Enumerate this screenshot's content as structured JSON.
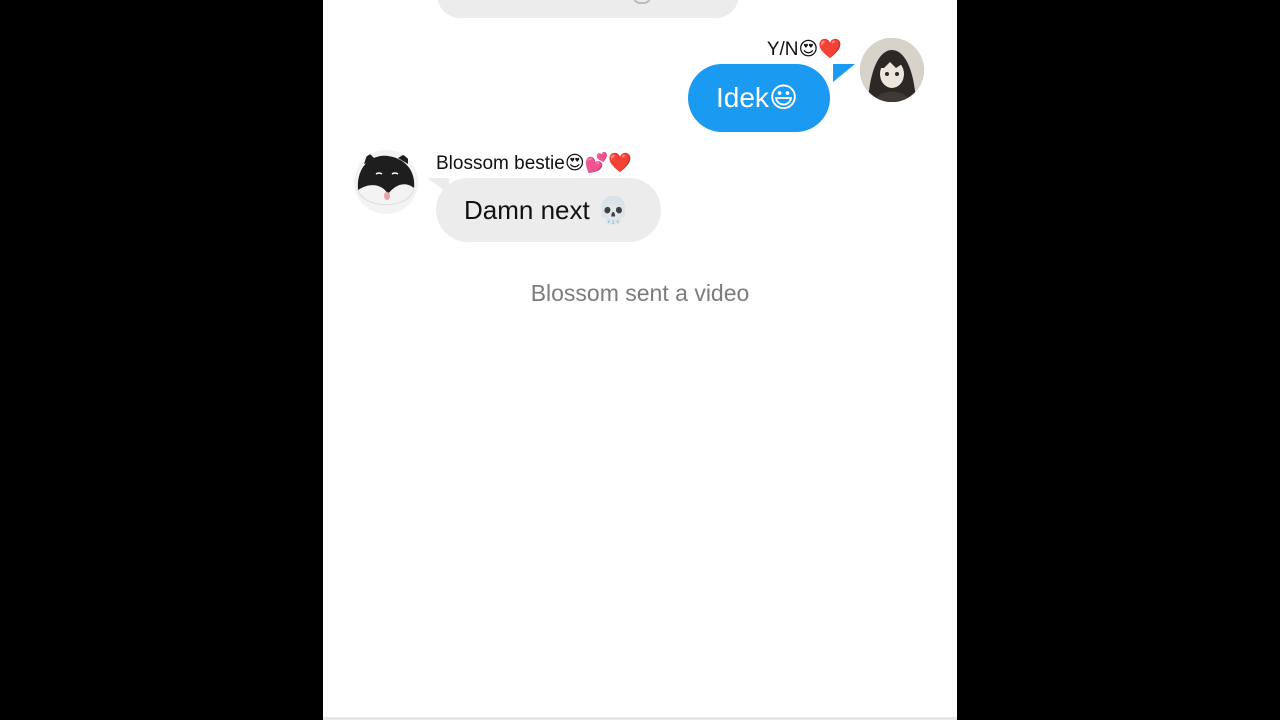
{
  "conversation": {
    "outgoing": {
      "sender_name": "Y/N😍❤️",
      "message": "Idek😃"
    },
    "incoming": {
      "sender_name": "Blossom bestie😍💕❤️",
      "message": "Damn next 💀"
    },
    "system_note": "Blossom sent a video"
  },
  "colors": {
    "outgoing_bubble": "#1a9af0",
    "incoming_bubble": "#ececec",
    "system_text": "#7c7c7c",
    "background": "#ffffff",
    "letterbox": "#000000"
  },
  "icons": {
    "my_avatar": "anime-girl-avatar-icon",
    "bestie_avatar": "cat-avatar-icon"
  }
}
